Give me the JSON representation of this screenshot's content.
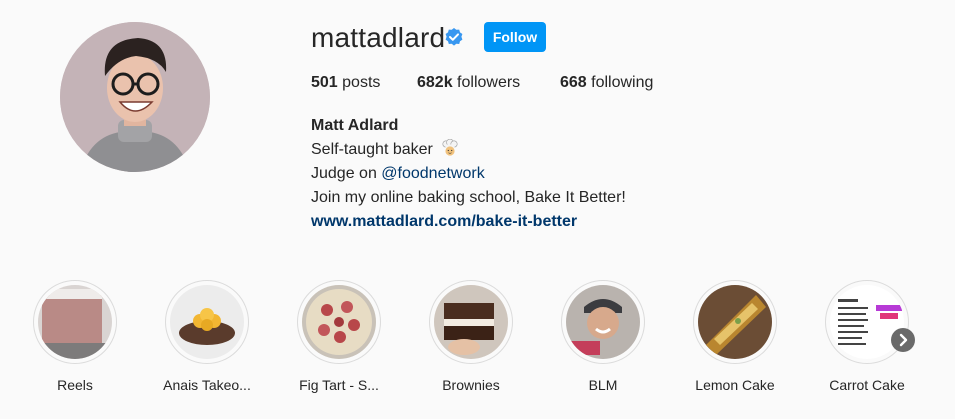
{
  "profile": {
    "username": "mattadlard",
    "follow_label": "Follow",
    "stats": {
      "posts_count": "501",
      "posts_label": " posts",
      "followers_count": "682k",
      "followers_label": " followers",
      "following_count": "668",
      "following_label": " following"
    },
    "bio": {
      "name": "Matt Adlard",
      "line1": "Self-taught baker ",
      "line2_prefix": "Judge on ",
      "mention": "@foodnetwork",
      "line3": "Join my online baking school, Bake It Better!",
      "website": "www.mattadlard.com/bake-it-better"
    }
  },
  "highlights": [
    {
      "label": "Reels"
    },
    {
      "label": "Anais Takeo..."
    },
    {
      "label": "Fig Tart - S..."
    },
    {
      "label": "Brownies"
    },
    {
      "label": "BLM"
    },
    {
      "label": "Lemon Cake"
    },
    {
      "label": "Carrot Cake"
    }
  ],
  "colors": {
    "accent": "#0095f6",
    "link": "#00376b",
    "verified": "#3897f0"
  },
  "icons": {
    "verified": "verified-badge-icon",
    "chef": "chef-emoji-icon",
    "next": "chevron-right-icon"
  }
}
